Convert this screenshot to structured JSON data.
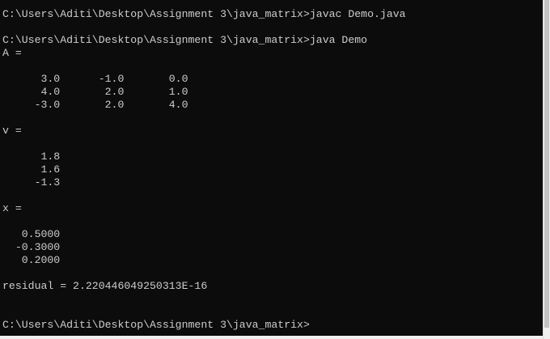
{
  "window": {
    "accent_text": "#cccccc",
    "background": "#0c0c0c"
  },
  "console": {
    "lines": [
      "C:\\Users\\Aditi\\Desktop\\Assignment 3\\java_matrix>javac Demo.java",
      "",
      "C:\\Users\\Aditi\\Desktop\\Assignment 3\\java_matrix>java Demo",
      "A =",
      "",
      "      3.0      -1.0       0.0",
      "      4.0       2.0       1.0",
      "     -3.0       2.0       4.0",
      "",
      "v =",
      "",
      "      1.8",
      "      1.6",
      "     -1.3",
      "",
      "x =",
      "",
      "   0.5000",
      "  -0.3000",
      "   0.2000",
      "",
      "residual = 2.220446049250313E-16",
      "",
      "",
      "C:\\Users\\Aditi\\Desktop\\Assignment 3\\java_matrix>"
    ]
  }
}
